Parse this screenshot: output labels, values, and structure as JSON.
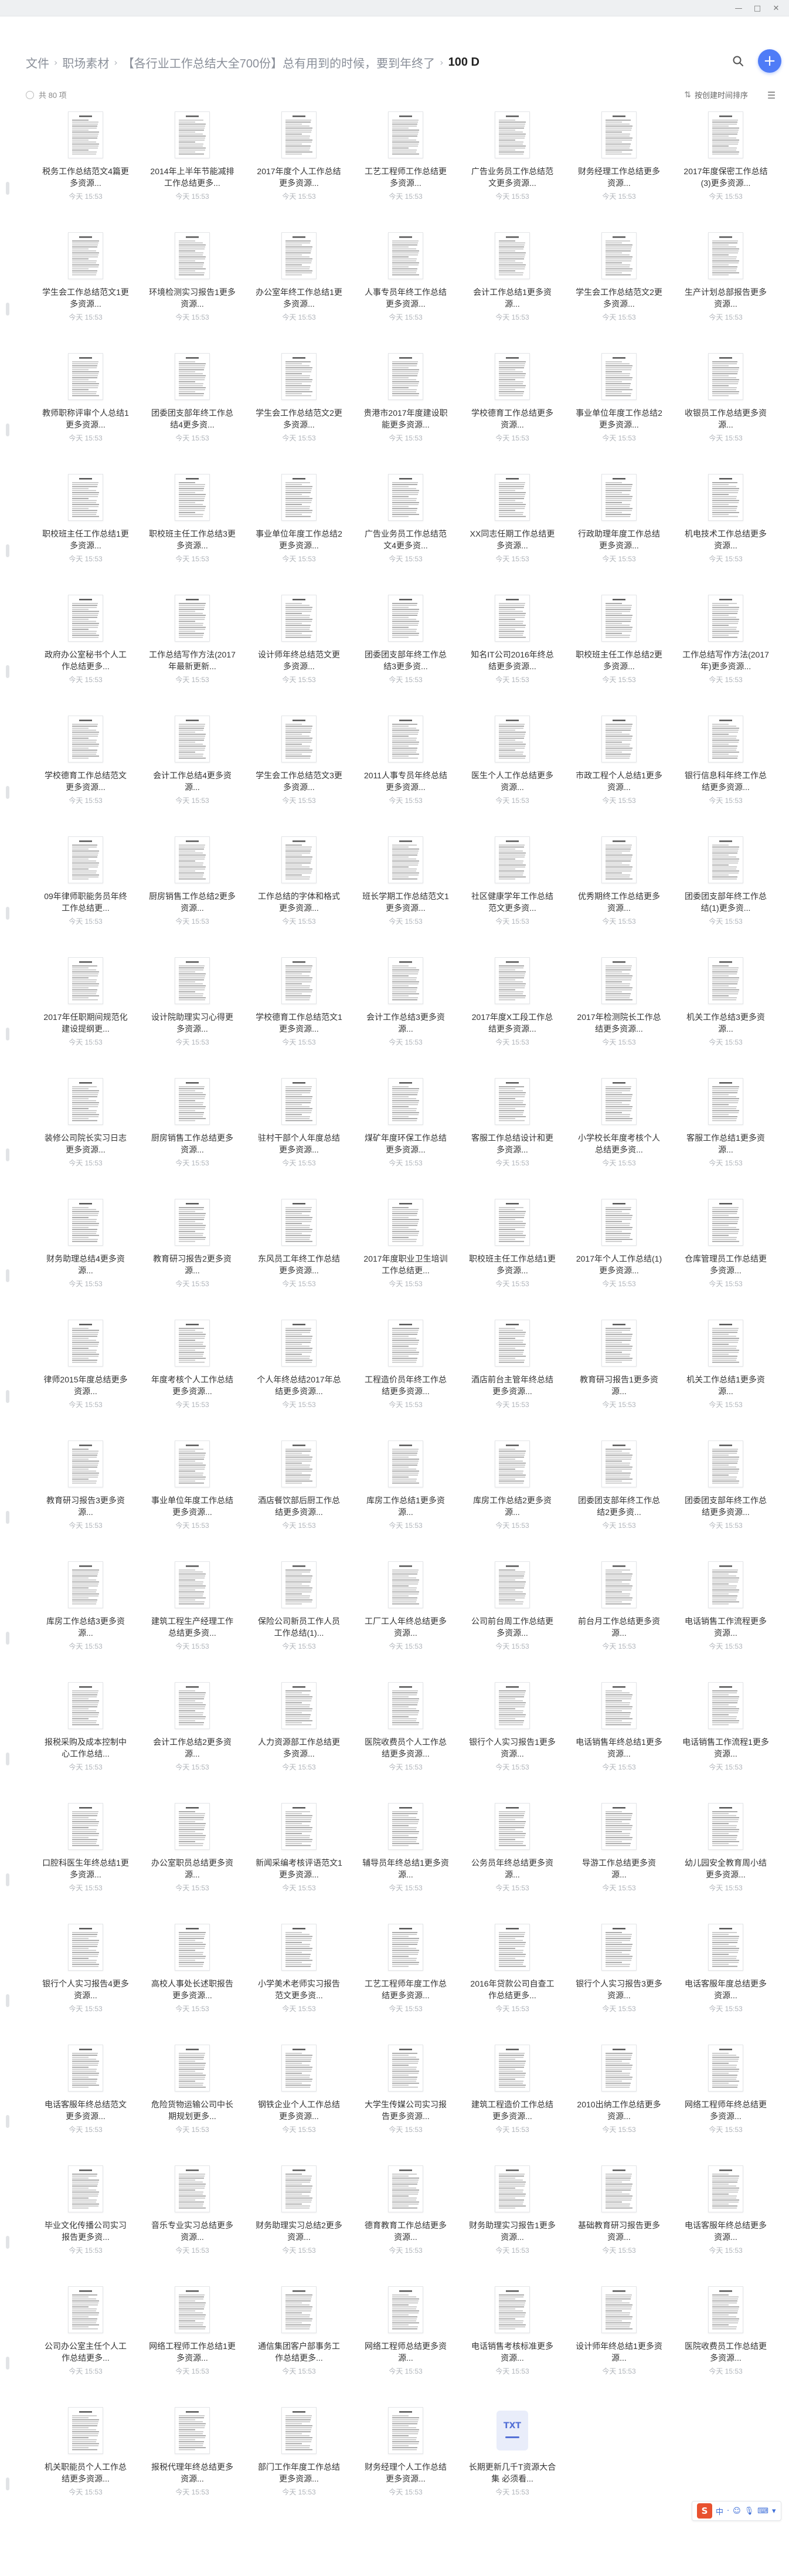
{
  "window": {
    "minimize": "—",
    "maximize": "□",
    "close": "✕"
  },
  "breadcrumb": [
    "文件",
    "职场素材",
    "【各行业工作总结大全700份】总有用到的时候，要到年终了",
    "100 D"
  ],
  "header": {
    "search_icon": "search-icon",
    "add_label": "+"
  },
  "toolbar": {
    "select_all": "共 80 项",
    "sort_label": "按创建时间排序",
    "sort_icon": "sort-icon",
    "view_icon": "list-view-icon"
  },
  "files": [
    {
      "name": "税务工作总结范文4篇更多资源...",
      "time": "今天 15:53",
      "thumb": "doc"
    },
    {
      "name": "2014年上半年节能减排工作总结更多...",
      "time": "今天 15:53",
      "thumb": "doc"
    },
    {
      "name": "2017年度个人工作总结更多资源...",
      "time": "今天 15:53",
      "thumb": "doc"
    },
    {
      "name": "工艺工程师工作总结更多资源...",
      "time": "今天 15:53",
      "thumb": "doc"
    },
    {
      "name": "广告业务员工作总结范文更多资源...",
      "time": "今天 15:53",
      "thumb": "doc"
    },
    {
      "name": "财务经理工作总结更多资源...",
      "time": "今天 15:53",
      "thumb": "doc"
    },
    {
      "name": "2017年度保密工作总结(3)更多资源...",
      "time": "今天 15:53",
      "thumb": "doc"
    },
    {
      "name": "学生会工作总结范文1更多资源...",
      "time": "今天 15:53",
      "thumb": "doc"
    },
    {
      "name": "环境检测实习报告1更多资源...",
      "time": "今天 15:53",
      "thumb": "doc"
    },
    {
      "name": "办公室年终工作总结1更多资源...",
      "time": "今天 15:53",
      "thumb": "doc"
    },
    {
      "name": "人事专员年终工作总结更多资源...",
      "time": "今天 15:53",
      "thumb": "doc"
    },
    {
      "name": "会计工作总结1更多资源...",
      "time": "今天 15:53",
      "thumb": "doc"
    },
    {
      "name": "学生会工作总结范文2更多资源...",
      "time": "今天 15:53",
      "thumb": "doc"
    },
    {
      "name": "生产计划总部报告更多资源...",
      "time": "今天 15:53",
      "thumb": "doc"
    },
    {
      "name": "教师职称评审个人总结1更多资源...",
      "time": "今天 15:53",
      "thumb": "doc"
    },
    {
      "name": "团委团支部年终工作总结4更多资...",
      "time": "今天 15:53",
      "thumb": "doc"
    },
    {
      "name": "学生会工作总结范文2更多资源...",
      "time": "今天 15:53",
      "thumb": "doc"
    },
    {
      "name": "贵港市2017年度建设职能更多资源...",
      "time": "今天 15:53",
      "thumb": "doc"
    },
    {
      "name": "学校德育工作总结更多资源...",
      "time": "今天 15:53",
      "thumb": "doc"
    },
    {
      "name": "事业单位年度工作总结2更多资源...",
      "time": "今天 15:53",
      "thumb": "doc"
    },
    {
      "name": "收银员工作总结更多资源...",
      "time": "今天 15:53",
      "thumb": "doc"
    },
    {
      "name": "职校班主任工作总结1更多资源...",
      "time": "今天 15:53",
      "thumb": "doc"
    },
    {
      "name": "职校班主任工作总结3更多资源...",
      "time": "今天 15:53",
      "thumb": "doc"
    },
    {
      "name": "事业单位年度工作总结2更多资源...",
      "time": "今天 15:53",
      "thumb": "doc"
    },
    {
      "name": "广告业务员工作总结范文4更多资...",
      "time": "今天 15:53",
      "thumb": "doc"
    },
    {
      "name": "XX同志任期工作总结更多资源...",
      "time": "今天 15:53",
      "thumb": "doc"
    },
    {
      "name": "行政助理年度工作总结更多资源...",
      "time": "今天 15:53",
      "thumb": "doc"
    },
    {
      "name": "机电技术工作总结更多资源...",
      "time": "今天 15:53",
      "thumb": "doc"
    },
    {
      "name": "政府办公室秘书个人工作总结更多...",
      "time": "今天 15:53",
      "thumb": "doc"
    },
    {
      "name": "工作总结写作方法(2017年最新更新...",
      "time": "今天 15:53",
      "thumb": "doc"
    },
    {
      "name": "设计师年终总结范文更多资源...",
      "time": "今天 15:53",
      "thumb": "doc"
    },
    {
      "name": "团委团支部年终工作总结3更多资...",
      "time": "今天 15:53",
      "thumb": "doc"
    },
    {
      "name": "知名IT公司2016年终总结更多资源...",
      "time": "今天 15:53",
      "thumb": "doc"
    },
    {
      "name": "职校班主任工作总结2更多资源...",
      "time": "今天 15:53",
      "thumb": "doc"
    },
    {
      "name": "工作总结写作方法(2017年)更多资源...",
      "time": "今天 15:53",
      "thumb": "doc"
    },
    {
      "name": "学校德育工作总结范文更多资源...",
      "time": "今天 15:53",
      "thumb": "doc"
    },
    {
      "name": "会计工作总结4更多资源...",
      "time": "今天 15:53",
      "thumb": "doc"
    },
    {
      "name": "学生会工作总结范文3更多资源...",
      "time": "今天 15:53",
      "thumb": "doc"
    },
    {
      "name": "2011人事专员年终总结更多资源...",
      "time": "今天 15:53",
      "thumb": "doc"
    },
    {
      "name": "医生个人工作总结更多资源...",
      "time": "今天 15:53",
      "thumb": "doc"
    },
    {
      "name": "市政工程个人总结1更多资源...",
      "time": "今天 15:53",
      "thumb": "doc"
    },
    {
      "name": "银行信息科年终工作总结更多资源...",
      "time": "今天 15:53",
      "thumb": "doc"
    },
    {
      "name": "09年律师职能务员年终工作总结更...",
      "time": "今天 15:53",
      "thumb": "doc"
    },
    {
      "name": "厨房销售工作总结2更多资源...",
      "time": "今天 15:53",
      "thumb": "doc"
    },
    {
      "name": "工作总结的字体和格式更多资源...",
      "time": "今天 15:53",
      "thumb": "doc"
    },
    {
      "name": "班长学期工作总结范文1更多资源...",
      "time": "今天 15:53",
      "thumb": "doc"
    },
    {
      "name": "社区健康学年工作总结范文更多资...",
      "time": "今天 15:53",
      "thumb": "doc"
    },
    {
      "name": "优秀期终工作总结更多资源...",
      "time": "今天 15:53",
      "thumb": "doc"
    },
    {
      "name": "团委团支部年终工作总结(1)更多资...",
      "time": "今天 15:53",
      "thumb": "doc"
    },
    {
      "name": "2017年任职期间规范化建设提纲更...",
      "time": "今天 15:53",
      "thumb": "doc"
    },
    {
      "name": "设计院助理实习心得更多资源...",
      "time": "今天 15:53",
      "thumb": "doc"
    },
    {
      "name": "学校德育工作总结范文1更多资源...",
      "time": "今天 15:53",
      "thumb": "doc"
    },
    {
      "name": "会计工作总结3更多资源...",
      "time": "今天 15:53",
      "thumb": "doc"
    },
    {
      "name": "2017年度X工段工作总结更多资源...",
      "time": "今天 15:53",
      "thumb": "doc"
    },
    {
      "name": "2017年检测院长工作总结更多资源...",
      "time": "今天 15:53",
      "thumb": "doc"
    },
    {
      "name": "机关工作总结3更多资源...",
      "time": "今天 15:53",
      "thumb": "doc"
    },
    {
      "name": "装修公司院长实习日志更多资源...",
      "time": "今天 15:53",
      "thumb": "doc"
    },
    {
      "name": "厨房销售工作总结更多资源...",
      "time": "今天 15:53",
      "thumb": "doc"
    },
    {
      "name": "驻村干部个人年度总结更多资源...",
      "time": "今天 15:53",
      "thumb": "doc"
    },
    {
      "name": "煤矿年度环保工作总结更多资源...",
      "time": "今天 15:53",
      "thumb": "doc"
    },
    {
      "name": "客服工作总结设计和更多资源...",
      "time": "今天 15:53",
      "thumb": "doc"
    },
    {
      "name": "小学校长年度考核个人总结更多资...",
      "time": "今天 15:53",
      "thumb": "doc"
    },
    {
      "name": "客服工作总结1更多资源...",
      "time": "今天 15:53",
      "thumb": "doc"
    },
    {
      "name": "财务助理总结4更多资源...",
      "time": "今天 15:53",
      "thumb": "doc"
    },
    {
      "name": "教育研习报告2更多资源...",
      "time": "今天 15:53",
      "thumb": "doc"
    },
    {
      "name": "东风员工年终工作总结更多资源...",
      "time": "今天 15:53",
      "thumb": "doc"
    },
    {
      "name": "2017年度职业卫生培训工作总结更...",
      "time": "今天 15:53",
      "thumb": "doc"
    },
    {
      "name": "职校班主任工作总结1更多资源...",
      "time": "今天 15:53",
      "thumb": "doc"
    },
    {
      "name": "2017年个人工作总结(1)更多资源...",
      "time": "今天 15:53",
      "thumb": "doc"
    },
    {
      "name": "仓库管理员工作总结更多资源...",
      "time": "今天 15:53",
      "thumb": "doc"
    },
    {
      "name": "律师2015年度总结更多资源...",
      "time": "今天 15:53",
      "thumb": "doc"
    },
    {
      "name": "年度考核个人工作总结更多资源...",
      "time": "今天 15:53",
      "thumb": "doc"
    },
    {
      "name": "个人年终总结2017年总结更多资源...",
      "time": "今天 15:53",
      "thumb": "doc"
    },
    {
      "name": "工程造价员年终工作总结更多资源...",
      "time": "今天 15:53",
      "thumb": "doc"
    },
    {
      "name": "酒店前台主管年终总结更多资源...",
      "time": "今天 15:53",
      "thumb": "doc"
    },
    {
      "name": "教育研习报告1更多资源...",
      "time": "今天 15:53",
      "thumb": "doc"
    },
    {
      "name": "机关工作总结1更多资源...",
      "time": "今天 15:53",
      "thumb": "doc"
    },
    {
      "name": "教育研习报告3更多资源...",
      "time": "今天 15:53",
      "thumb": "doc"
    },
    {
      "name": "事业单位年度工作总结更多资源...",
      "time": "今天 15:53",
      "thumb": "doc"
    },
    {
      "name": "酒店餐饮部后厨工作总结更多资源...",
      "time": "今天 15:53",
      "thumb": "doc"
    },
    {
      "name": "库房工作总结1更多资源...",
      "time": "今天 15:53",
      "thumb": "doc"
    },
    {
      "name": "库房工作总结2更多资源...",
      "time": "今天 15:53",
      "thumb": "doc"
    },
    {
      "name": "团委团支部年终工作总结2更多资...",
      "time": "今天 15:53",
      "thumb": "doc"
    },
    {
      "name": "团委团支部年终工作总结更多资源...",
      "time": "今天 15:53",
      "thumb": "doc"
    },
    {
      "name": "库房工作总结3更多资源...",
      "time": "今天 15:53",
      "thumb": "doc"
    },
    {
      "name": "建筑工程生产经理工作总结更多资...",
      "time": "今天 15:53",
      "thumb": "doc"
    },
    {
      "name": "保险公司新员工作人员工作总结(1)...",
      "time": "今天 15:53",
      "thumb": "doc"
    },
    {
      "name": "工厂工人年终总结更多资源...",
      "time": "今天 15:53",
      "thumb": "doc"
    },
    {
      "name": "公司前台周工作总结更多资源...",
      "time": "今天 15:53",
      "thumb": "doc"
    },
    {
      "name": "前台月工作总结更多资源...",
      "time": "今天 15:53",
      "thumb": "doc"
    },
    {
      "name": "电话销售工作流程更多资源...",
      "time": "今天 15:53",
      "thumb": "doc"
    },
    {
      "name": "报税采购及成本控制中心工作总结...",
      "time": "今天 15:53",
      "thumb": "doc"
    },
    {
      "name": "会计工作总结2更多资源...",
      "time": "今天 15:53",
      "thumb": "doc"
    },
    {
      "name": "人力资源部工作总结更多资源...",
      "time": "今天 15:53",
      "thumb": "doc"
    },
    {
      "name": "医院收费员个人工作总结更多资源...",
      "time": "今天 15:53",
      "thumb": "doc"
    },
    {
      "name": "银行个人实习报告1更多资源...",
      "time": "今天 15:53",
      "thumb": "doc"
    },
    {
      "name": "电话销售年终总结1更多资源...",
      "time": "今天 15:53",
      "thumb": "doc"
    },
    {
      "name": "电话销售工作流程1更多资源...",
      "time": "今天 15:53",
      "thumb": "doc"
    },
    {
      "name": "口腔科医生年终总结1更多资源...",
      "time": "今天 15:53",
      "thumb": "doc"
    },
    {
      "name": "办公室职员总结更多资源...",
      "time": "今天 15:53",
      "thumb": "doc"
    },
    {
      "name": "新闻采编考核评语范文1更多资源...",
      "time": "今天 15:53",
      "thumb": "doc"
    },
    {
      "name": "辅导员年终总结1更多资源...",
      "time": "今天 15:53",
      "thumb": "doc"
    },
    {
      "name": "公务员年终总结更多资源...",
      "time": "今天 15:53",
      "thumb": "doc"
    },
    {
      "name": "导游工作总结更多资源...",
      "time": "今天 15:53",
      "thumb": "doc"
    },
    {
      "name": "幼儿园安全教育周小结更多资源...",
      "time": "今天 15:53",
      "thumb": "doc"
    },
    {
      "name": "银行个人实习报告4更多资源...",
      "time": "今天 15:53",
      "thumb": "doc"
    },
    {
      "name": "高校人事处长述职报告更多资源...",
      "time": "今天 15:53",
      "thumb": "doc"
    },
    {
      "name": "小学美术老师实习报告范文更多资...",
      "time": "今天 15:53",
      "thumb": "doc"
    },
    {
      "name": "工艺工程师年度工作总结更多资源...",
      "time": "今天 15:53",
      "thumb": "doc"
    },
    {
      "name": "2016年贷款公司自查工作总结更多...",
      "time": "今天 15:53",
      "thumb": "doc"
    },
    {
      "name": "银行个人实习报告3更多资源...",
      "time": "今天 15:53",
      "thumb": "doc"
    },
    {
      "name": "电话客服年度总结更多资源...",
      "time": "今天 15:53",
      "thumb": "doc"
    },
    {
      "name": "电话客服年终总结范文更多资源...",
      "time": "今天 15:53",
      "thumb": "doc"
    },
    {
      "name": "危险货物运输公司中长期规划更多...",
      "time": "今天 15:53",
      "thumb": "doc"
    },
    {
      "name": "钢铁企业个人工作总结更多资源...",
      "time": "今天 15:53",
      "thumb": "doc"
    },
    {
      "name": "大学生传媒公司实习报告更多资源...",
      "time": "今天 15:53",
      "thumb": "doc"
    },
    {
      "name": "建筑工程造价工作总结更多资源...",
      "time": "今天 15:53",
      "thumb": "doc"
    },
    {
      "name": "2010出纳工作总结更多资源...",
      "time": "今天 15:53",
      "thumb": "doc"
    },
    {
      "name": "网络工程师年终总结更多资源...",
      "time": "今天 15:53",
      "thumb": "doc"
    },
    {
      "name": "毕业文化传播公司实习报告更多资...",
      "time": "今天 15:53",
      "thumb": "doc"
    },
    {
      "name": "音乐专业实习总结更多资源...",
      "time": "今天 15:53",
      "thumb": "doc"
    },
    {
      "name": "财务助理实习总结2更多资源...",
      "time": "今天 15:53",
      "thumb": "doc"
    },
    {
      "name": "德育教育工作总结更多资源...",
      "time": "今天 15:53",
      "thumb": "doc"
    },
    {
      "name": "财务助理实习报告1更多资源...",
      "time": "今天 15:53",
      "thumb": "doc"
    },
    {
      "name": "基础教育研习报告更多资源...",
      "time": "今天 15:53",
      "thumb": "doc"
    },
    {
      "name": "电话客服年终总结更多资源...",
      "time": "今天 15:53",
      "thumb": "doc"
    },
    {
      "name": "公司办公室主任个人工作总结更多...",
      "time": "今天 15:53",
      "thumb": "doc"
    },
    {
      "name": "网络工程师工作总结1更多资源...",
      "time": "今天 15:53",
      "thumb": "doc"
    },
    {
      "name": "通信集团客户部事务工作总结更多...",
      "time": "今天 15:53",
      "thumb": "doc"
    },
    {
      "name": "网络工程师总结更多资源...",
      "time": "今天 15:53",
      "thumb": "doc"
    },
    {
      "name": "电话销售考核标准更多资源...",
      "time": "今天 15:53",
      "thumb": "doc"
    },
    {
      "name": "设计师年终总结1更多资源...",
      "time": "今天 15:53",
      "thumb": "doc"
    },
    {
      "name": "医院收费员工作总结更多资源...",
      "time": "今天 15:53",
      "thumb": "doc"
    },
    {
      "name": "机关职能员个人工作总结更多资源...",
      "time": "今天 15:53",
      "thumb": "doc"
    },
    {
      "name": "报税代理年终总结更多资源...",
      "time": "今天 15:53",
      "thumb": "doc"
    },
    {
      "name": "部门工作年度工作总结更多资源...",
      "time": "今天 15:53",
      "thumb": "doc"
    },
    {
      "name": "财务经理个人工作总结更多资源...",
      "time": "今天 15:53",
      "thumb": "doc"
    },
    {
      "name": "长期更新几千T资源大合集 必须看...",
      "time": "今天 15:53",
      "thumb": "txt",
      "thumb_label": "TXT"
    }
  ],
  "tray": {
    "logo": "S",
    "items": [
      "中",
      "·",
      "☺",
      "🎙",
      "⌨",
      "▾"
    ]
  },
  "colors": {
    "accent": "#4f7cf7",
    "text": "#333333",
    "muted": "#b0b4ba"
  }
}
